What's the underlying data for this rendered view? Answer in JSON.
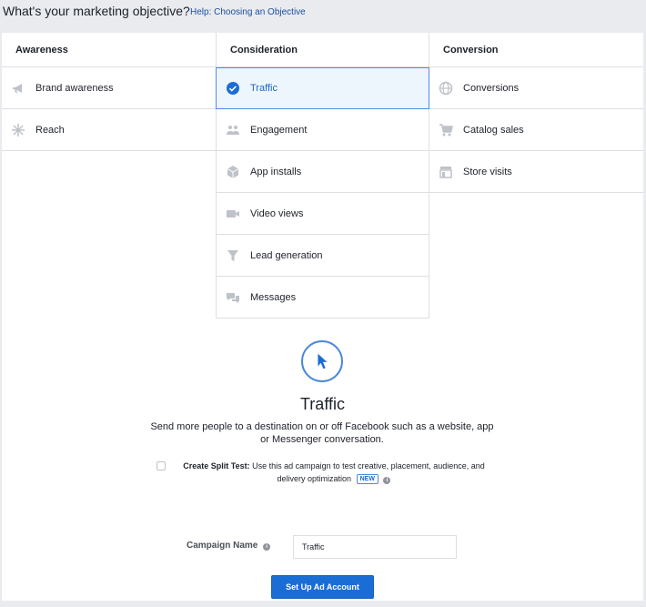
{
  "header": {
    "title": "What's your marketing objective?",
    "help_link": "Help: Choosing an Objective"
  },
  "columns": [
    {
      "heading": "Awareness",
      "items": [
        {
          "label": "Brand awareness",
          "icon": "megaphone-icon"
        },
        {
          "label": "Reach",
          "icon": "reach-icon"
        }
      ]
    },
    {
      "heading": "Consideration",
      "items": [
        {
          "label": "Traffic",
          "icon": "check-circle-icon",
          "selected": true
        },
        {
          "label": "Engagement",
          "icon": "people-icon"
        },
        {
          "label": "App installs",
          "icon": "cube-icon"
        },
        {
          "label": "Video views",
          "icon": "video-camera-icon"
        },
        {
          "label": "Lead generation",
          "icon": "funnel-icon"
        },
        {
          "label": "Messages",
          "icon": "chat-bubbles-icon"
        }
      ]
    },
    {
      "heading": "Conversion",
      "items": [
        {
          "label": "Conversions",
          "icon": "globe-icon"
        },
        {
          "label": "Catalog sales",
          "icon": "shopping-cart-icon"
        },
        {
          "label": "Store visits",
          "icon": "store-icon"
        }
      ]
    }
  ],
  "detail": {
    "icon": "cursor-icon",
    "title": "Traffic",
    "description": "Send more people to a destination on or off Facebook such as a website, app or Messenger conversation."
  },
  "split_test": {
    "label": "Create Split Test:",
    "text": "Use this ad campaign to test creative, placement, audience, and delivery optimization",
    "badge": "NEW",
    "checked": false
  },
  "campaign": {
    "label": "Campaign Name",
    "value": "Traffic"
  },
  "setup_button": "Set Up Ad Account",
  "colors": {
    "accent": "#1b6dd6",
    "selected_bg": "#edf5fd",
    "selected_border": "#4c8fe0",
    "icon_gray": "#bec2c9"
  }
}
